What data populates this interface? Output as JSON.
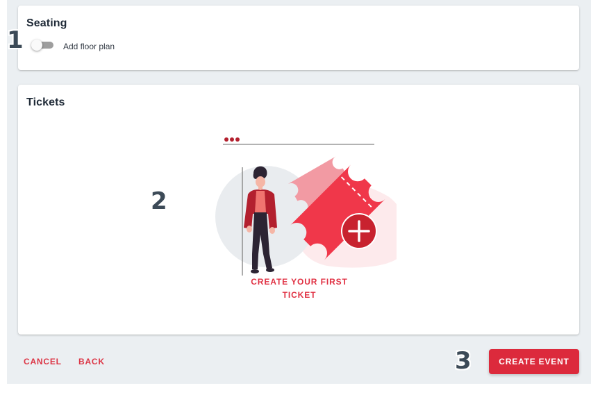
{
  "seating": {
    "title": "Seating",
    "toggle_label": "Add floor plan",
    "toggle_on": false
  },
  "tickets": {
    "title": "Tickets",
    "empty_cta": "CREATE YOUR FIRST TICKET"
  },
  "footer": {
    "cancel_label": "CANCEL",
    "back_label": "BACK",
    "create_label": "CREATE EVENT"
  },
  "markers": {
    "one": "1",
    "two": "2",
    "three": "3"
  },
  "colors": {
    "accent": "#dc2a3c",
    "page_bg": "#ebeff2",
    "card_bg": "#ffffff",
    "ticket_pink": "#f5949e"
  },
  "icons": {
    "illustration": "person-with-tickets-illustration",
    "plus": "plus-circle-icon"
  }
}
